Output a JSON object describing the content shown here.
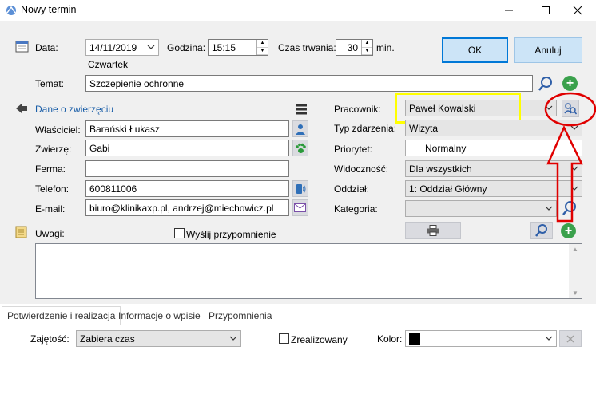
{
  "window": {
    "title": "Nowy termin"
  },
  "form": {
    "data_label": "Data:",
    "data_value": "14/11/2019",
    "weekday": "Czwartek",
    "godzina_label": "Godzina:",
    "godzina_value": "15:15",
    "czas_label": "Czas trwania:",
    "czas_value": "30",
    "czas_unit": "min.",
    "temat_label": "Temat:",
    "temat_value": "Szczepienie ochronne"
  },
  "buttons": {
    "ok": "OK",
    "anuluj": "Anuluj"
  },
  "animal": {
    "section_title": "Dane o zwierzęciu",
    "wlasciciel_label": "Właściciel:",
    "wlasciciel_value": "Barański Łukasz",
    "zwierze_label": "Zwierzę:",
    "zwierze_value": "Gabi",
    "ferma_label": "Ferma:",
    "ferma_value": "",
    "telefon_label": "Telefon:",
    "telefon_value": "600811006",
    "email_label": "E-mail:",
    "email_value": "biuro@klinikaxp.pl, andrzej@miechowicz.pl"
  },
  "right": {
    "pracownik_label": "Pracownik:",
    "pracownik_value": "Paweł Kowalski",
    "typ_label": "Typ zdarzenia:",
    "typ_value": "Wizyta",
    "priorytet_label": "Priorytet:",
    "priorytet_value": "Normalny",
    "widocznosc_label": "Widoczność:",
    "widocznosc_value": "Dla wszystkich",
    "oddzial_label": "Oddział:",
    "oddzial_value": "1: Oddział Główny",
    "kategoria_label": "Kategoria:",
    "kategoria_value": ""
  },
  "uwagi": {
    "label": "Uwagi:",
    "reminder_label": "Wyślij przypomnienie",
    "text": ""
  },
  "tabs": [
    {
      "label": "Potwierdzenie i realizacja"
    },
    {
      "label": "Informacje o wpisie"
    },
    {
      "label": "Przypomnienia"
    }
  ],
  "bottom": {
    "zajetosc_label": "Zajętość:",
    "zajetosc_value": "Zabiera czas",
    "zrealizowany_label": "Zrealizowany",
    "kolor_label": "Kolor:",
    "kolor_value": "#000000"
  },
  "colors": {
    "highlight": "#ffff00",
    "annotation": "#e00000",
    "accent": "#0078d7",
    "section_title": "#1a5ea8"
  }
}
